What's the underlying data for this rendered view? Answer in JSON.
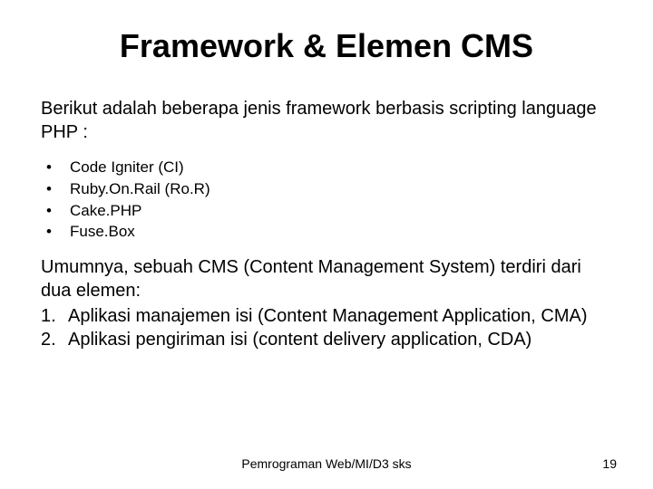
{
  "title": "Framework & Elemen CMS",
  "intro": "Berikut adalah beberapa jenis framework berbasis scripting language PHP :",
  "bullets": [
    "Code Igniter (CI)",
    "Ruby.On.Rail (Ro.R)",
    "Cake.PHP",
    "Fuse.Box"
  ],
  "body": "Umumnya, sebuah CMS (Content Management System) terdiri dari dua elemen:",
  "numbered": [
    "Aplikasi manajemen isi (Content Management Application, CMA)",
    "Aplikasi pengiriman isi (content delivery application, CDA)"
  ],
  "footer": "Pemrograman Web/MI/D3 sks",
  "page": "19"
}
